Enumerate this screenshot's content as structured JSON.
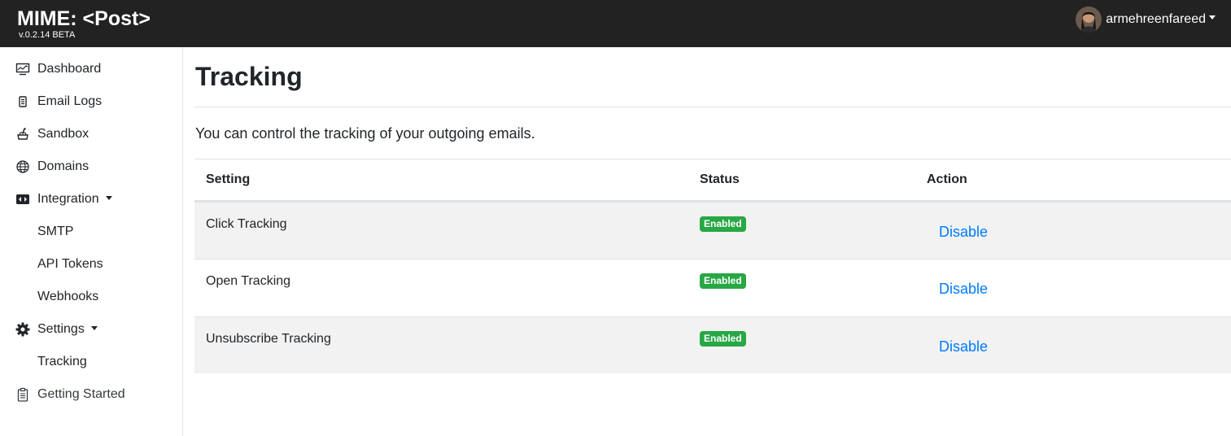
{
  "header": {
    "brand": "MIME: <Post>",
    "version": "v.0.2.14 BETA",
    "user": {
      "name": "armehreenfareed",
      "avatar_icon": "user-avatar-photo"
    }
  },
  "sidebar": {
    "items": [
      {
        "label": "Dashboard",
        "icon": "monitor-chart-icon"
      },
      {
        "label": "Email Logs",
        "icon": "file-list-icon"
      },
      {
        "label": "Sandbox",
        "icon": "sandbox-icon"
      },
      {
        "label": "Domains",
        "icon": "globe-icon"
      },
      {
        "label": "Integration",
        "icon": "integration-icon",
        "dropdown": true
      },
      {
        "label": "SMTP"
      },
      {
        "label": "API Tokens"
      },
      {
        "label": "Webhooks"
      },
      {
        "label": "Settings",
        "icon": "gear-icon",
        "dropdown": true
      },
      {
        "label": "Tracking",
        "active": true
      },
      {
        "label": "Getting Started",
        "icon": "clipboard-icon"
      }
    ]
  },
  "main": {
    "title": "Tracking",
    "description": "You can control the tracking of your outgoing emails.",
    "table": {
      "headers": [
        "Setting",
        "Status",
        "Action"
      ],
      "rows": [
        {
          "setting": "Click Tracking",
          "status": "Enabled",
          "action": "Disable"
        },
        {
          "setting": "Open Tracking",
          "status": "Enabled",
          "action": "Disable"
        },
        {
          "setting": "Unsubscribe Tracking",
          "status": "Enabled",
          "action": "Disable"
        }
      ]
    }
  },
  "colors": {
    "topbar": "#222222",
    "link": "#007bff",
    "badge_success": "#28a745",
    "stripe": "#f2f2f2"
  }
}
